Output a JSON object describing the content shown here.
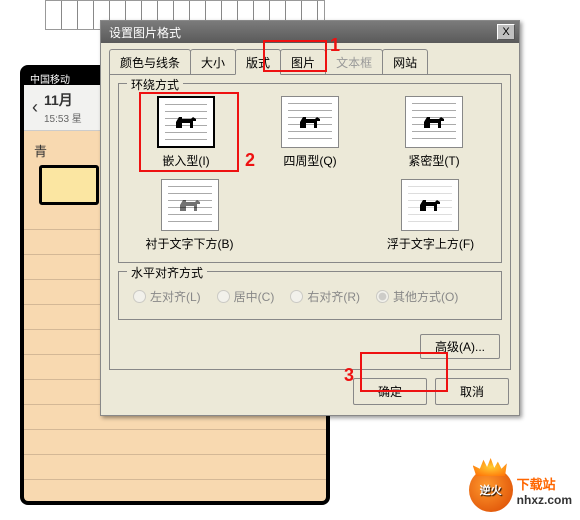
{
  "phone": {
    "carrier": "中国移动",
    "back": "‹",
    "date": "11月",
    "time": "15:53 星",
    "body_char": "青"
  },
  "dialog": {
    "title": "设置图片格式",
    "close": "X",
    "tabs": {
      "colors": "颜色与线条",
      "size": "大小",
      "layout": "版式",
      "picture": "图片",
      "textbox": "文本框",
      "web": "网站"
    },
    "wrap": {
      "legend": "环绕方式",
      "inline": "嵌入型(I)",
      "square": "四周型(Q)",
      "tight": "紧密型(T)",
      "behind": "衬于文字下方(B)",
      "front": "浮于文字上方(F)"
    },
    "align": {
      "legend": "水平对齐方式",
      "left": "左对齐(L)",
      "center": "居中(C)",
      "right": "右对齐(R)",
      "other": "其他方式(O)"
    },
    "advanced": "高级(A)...",
    "ok": "确定",
    "cancel": "取消"
  },
  "annotations": {
    "n1": "1",
    "n2": "2",
    "n3": "3"
  },
  "watermark": {
    "logo_text": "逆火",
    "cn": "下载站",
    "url": "nhxz.com"
  },
  "colors": {
    "highlight": "#e11"
  }
}
